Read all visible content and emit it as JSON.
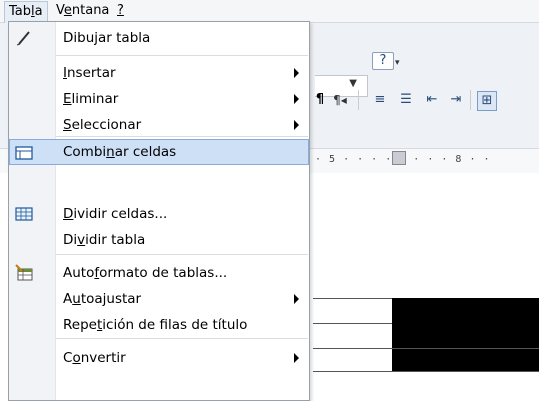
{
  "menubar": {
    "items": [
      {
        "label": "Tabla",
        "active": true
      },
      {
        "label": "Ventana",
        "active": false
      },
      {
        "label": "?",
        "active": false
      }
    ]
  },
  "toolbar": {
    "help_glyph": "?",
    "ruler_text": "· 5 · ·  · · 7 · · · 8 · · "
  },
  "menu": {
    "items": [
      {
        "label": "Dibujar tabla",
        "icon": "pencil-icon",
        "submenu": false,
        "highlighted": false
      },
      {
        "label": "Insertar",
        "icon": "",
        "submenu": true,
        "highlighted": false
      },
      {
        "label": "Eliminar",
        "icon": "",
        "submenu": true,
        "highlighted": false
      },
      {
        "label": "Seleccionar",
        "icon": "",
        "submenu": true,
        "highlighted": false
      },
      {
        "label": "Combinar celdas",
        "icon": "merge-cells-icon",
        "submenu": false,
        "highlighted": true
      },
      {
        "label": "Dividir celdas...",
        "icon": "split-cells-icon",
        "submenu": false,
        "highlighted": false
      },
      {
        "label": "Dividir tabla",
        "icon": "",
        "submenu": false,
        "highlighted": false
      },
      {
        "label": "Autoformato de tablas...",
        "icon": "table-autoformat-icon",
        "submenu": false,
        "highlighted": false
      },
      {
        "label": "Autoajustar",
        "icon": "",
        "submenu": true,
        "highlighted": false
      },
      {
        "label": "Repetición de filas de título",
        "icon": "",
        "submenu": false,
        "highlighted": false
      },
      {
        "label": "Convertir",
        "icon": "",
        "submenu": true,
        "highlighted": false
      }
    ]
  },
  "colors": {
    "highlight_bg": "#cde0f6",
    "highlight_border": "#86acdc",
    "menu_border": "#97a0ab"
  }
}
